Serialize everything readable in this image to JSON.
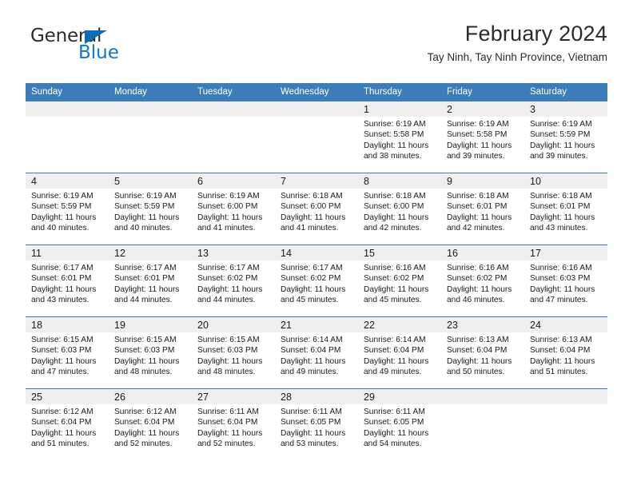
{
  "brand": {
    "logo_text_primary": "General",
    "logo_text_secondary": "Blue",
    "triangle_icon": "triangle-icon",
    "accent_color": "#0a6cb4",
    "header_blue": "#3c7cb8",
    "band_gray": "#efeff0"
  },
  "header": {
    "title": "February 2024",
    "subtitle": "Tay Ninh, Tay Ninh Province, Vietnam"
  },
  "calendar": {
    "weekday_headers": [
      "Sunday",
      "Monday",
      "Tuesday",
      "Wednesday",
      "Thursday",
      "Friday",
      "Saturday"
    ],
    "weeks": [
      [
        {
          "day": "",
          "empty": true,
          "lines": []
        },
        {
          "day": "",
          "empty": true,
          "lines": []
        },
        {
          "day": "",
          "empty": true,
          "lines": []
        },
        {
          "day": "",
          "empty": true,
          "lines": []
        },
        {
          "day": "1",
          "empty": false,
          "lines": [
            "Sunrise: 6:19 AM",
            "Sunset: 5:58 PM",
            "Daylight: 11 hours",
            "and 38 minutes."
          ]
        },
        {
          "day": "2",
          "empty": false,
          "lines": [
            "Sunrise: 6:19 AM",
            "Sunset: 5:58 PM",
            "Daylight: 11 hours",
            "and 39 minutes."
          ]
        },
        {
          "day": "3",
          "empty": false,
          "lines": [
            "Sunrise: 6:19 AM",
            "Sunset: 5:59 PM",
            "Daylight: 11 hours",
            "and 39 minutes."
          ]
        }
      ],
      [
        {
          "day": "4",
          "empty": false,
          "lines": [
            "Sunrise: 6:19 AM",
            "Sunset: 5:59 PM",
            "Daylight: 11 hours",
            "and 40 minutes."
          ]
        },
        {
          "day": "5",
          "empty": false,
          "lines": [
            "Sunrise: 6:19 AM",
            "Sunset: 5:59 PM",
            "Daylight: 11 hours",
            "and 40 minutes."
          ]
        },
        {
          "day": "6",
          "empty": false,
          "lines": [
            "Sunrise: 6:19 AM",
            "Sunset: 6:00 PM",
            "Daylight: 11 hours",
            "and 41 minutes."
          ]
        },
        {
          "day": "7",
          "empty": false,
          "lines": [
            "Sunrise: 6:18 AM",
            "Sunset: 6:00 PM",
            "Daylight: 11 hours",
            "and 41 minutes."
          ]
        },
        {
          "day": "8",
          "empty": false,
          "lines": [
            "Sunrise: 6:18 AM",
            "Sunset: 6:00 PM",
            "Daylight: 11 hours",
            "and 42 minutes."
          ]
        },
        {
          "day": "9",
          "empty": false,
          "lines": [
            "Sunrise: 6:18 AM",
            "Sunset: 6:01 PM",
            "Daylight: 11 hours",
            "and 42 minutes."
          ]
        },
        {
          "day": "10",
          "empty": false,
          "lines": [
            "Sunrise: 6:18 AM",
            "Sunset: 6:01 PM",
            "Daylight: 11 hours",
            "and 43 minutes."
          ]
        }
      ],
      [
        {
          "day": "11",
          "empty": false,
          "lines": [
            "Sunrise: 6:17 AM",
            "Sunset: 6:01 PM",
            "Daylight: 11 hours",
            "and 43 minutes."
          ]
        },
        {
          "day": "12",
          "empty": false,
          "lines": [
            "Sunrise: 6:17 AM",
            "Sunset: 6:01 PM",
            "Daylight: 11 hours",
            "and 44 minutes."
          ]
        },
        {
          "day": "13",
          "empty": false,
          "lines": [
            "Sunrise: 6:17 AM",
            "Sunset: 6:02 PM",
            "Daylight: 11 hours",
            "and 44 minutes."
          ]
        },
        {
          "day": "14",
          "empty": false,
          "lines": [
            "Sunrise: 6:17 AM",
            "Sunset: 6:02 PM",
            "Daylight: 11 hours",
            "and 45 minutes."
          ]
        },
        {
          "day": "15",
          "empty": false,
          "lines": [
            "Sunrise: 6:16 AM",
            "Sunset: 6:02 PM",
            "Daylight: 11 hours",
            "and 45 minutes."
          ]
        },
        {
          "day": "16",
          "empty": false,
          "lines": [
            "Sunrise: 6:16 AM",
            "Sunset: 6:02 PM",
            "Daylight: 11 hours",
            "and 46 minutes."
          ]
        },
        {
          "day": "17",
          "empty": false,
          "lines": [
            "Sunrise: 6:16 AM",
            "Sunset: 6:03 PM",
            "Daylight: 11 hours",
            "and 47 minutes."
          ]
        }
      ],
      [
        {
          "day": "18",
          "empty": false,
          "lines": [
            "Sunrise: 6:15 AM",
            "Sunset: 6:03 PM",
            "Daylight: 11 hours",
            "and 47 minutes."
          ]
        },
        {
          "day": "19",
          "empty": false,
          "lines": [
            "Sunrise: 6:15 AM",
            "Sunset: 6:03 PM",
            "Daylight: 11 hours",
            "and 48 minutes."
          ]
        },
        {
          "day": "20",
          "empty": false,
          "lines": [
            "Sunrise: 6:15 AM",
            "Sunset: 6:03 PM",
            "Daylight: 11 hours",
            "and 48 minutes."
          ]
        },
        {
          "day": "21",
          "empty": false,
          "lines": [
            "Sunrise: 6:14 AM",
            "Sunset: 6:04 PM",
            "Daylight: 11 hours",
            "and 49 minutes."
          ]
        },
        {
          "day": "22",
          "empty": false,
          "lines": [
            "Sunrise: 6:14 AM",
            "Sunset: 6:04 PM",
            "Daylight: 11 hours",
            "and 49 minutes."
          ]
        },
        {
          "day": "23",
          "empty": false,
          "lines": [
            "Sunrise: 6:13 AM",
            "Sunset: 6:04 PM",
            "Daylight: 11 hours",
            "and 50 minutes."
          ]
        },
        {
          "day": "24",
          "empty": false,
          "lines": [
            "Sunrise: 6:13 AM",
            "Sunset: 6:04 PM",
            "Daylight: 11 hours",
            "and 51 minutes."
          ]
        }
      ],
      [
        {
          "day": "25",
          "empty": false,
          "lines": [
            "Sunrise: 6:12 AM",
            "Sunset: 6:04 PM",
            "Daylight: 11 hours",
            "and 51 minutes."
          ]
        },
        {
          "day": "26",
          "empty": false,
          "lines": [
            "Sunrise: 6:12 AM",
            "Sunset: 6:04 PM",
            "Daylight: 11 hours",
            "and 52 minutes."
          ]
        },
        {
          "day": "27",
          "empty": false,
          "lines": [
            "Sunrise: 6:11 AM",
            "Sunset: 6:04 PM",
            "Daylight: 11 hours",
            "and 52 minutes."
          ]
        },
        {
          "day": "28",
          "empty": false,
          "lines": [
            "Sunrise: 6:11 AM",
            "Sunset: 6:05 PM",
            "Daylight: 11 hours",
            "and 53 minutes."
          ]
        },
        {
          "day": "29",
          "empty": false,
          "lines": [
            "Sunrise: 6:11 AM",
            "Sunset: 6:05 PM",
            "Daylight: 11 hours",
            "and 54 minutes."
          ]
        },
        {
          "day": "",
          "empty": true,
          "lines": []
        },
        {
          "day": "",
          "empty": true,
          "lines": []
        }
      ]
    ]
  }
}
